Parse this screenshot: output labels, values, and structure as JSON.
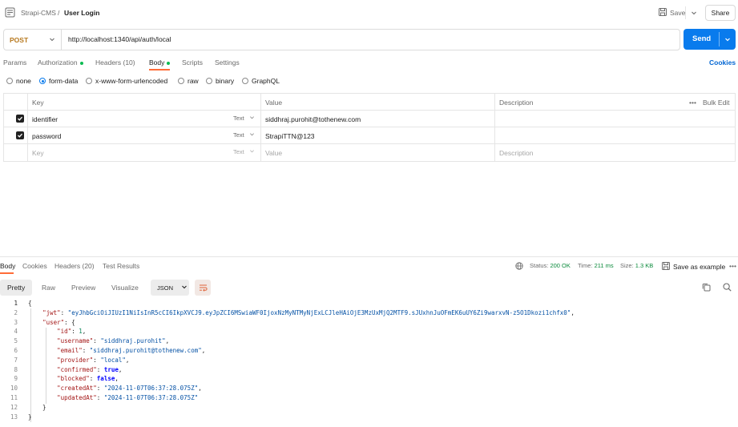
{
  "header": {
    "collection": "Strapi-CMS",
    "separator": "/",
    "request_name": "User Login",
    "save_label": "Save",
    "share_label": "Share"
  },
  "request": {
    "method": "POST",
    "url": "http://localhost:1340/api/auth/local",
    "send_label": "Send",
    "tabs": [
      "Params",
      "Authorization",
      "Headers (10)",
      "Body",
      "Scripts",
      "Settings"
    ],
    "active_tab": "Body",
    "cookies_label": "Cookies",
    "body_types": [
      "none",
      "form-data",
      "x-www-form-urlencoded",
      "raw",
      "binary",
      "GraphQL"
    ],
    "selected_body_type": "form-data"
  },
  "form_table": {
    "headers": {
      "key": "Key",
      "value": "Value",
      "description": "Description",
      "bulk_edit": "Bulk Edit"
    },
    "rows": [
      {
        "key": "identifier",
        "type": "Text",
        "value": "siddhraj.purohit@tothenew.com",
        "checked": true
      },
      {
        "key": "password",
        "type": "Text",
        "value": "StrapiTTN@123",
        "checked": true
      }
    ],
    "placeholder": {
      "key": "Key",
      "type": "Text",
      "value": "Value",
      "description": "Description"
    }
  },
  "response": {
    "tabs": [
      "Body",
      "Cookies",
      "Headers (20)",
      "Test Results"
    ],
    "active_tab": "Body",
    "status_label": "Status:",
    "status_value": "200 OK",
    "time_label": "Time:",
    "time_value": "211 ms",
    "size_label": "Size:",
    "size_value": "1.3 KB",
    "save_example_label": "Save as example",
    "view_modes": [
      "Pretty",
      "Raw",
      "Preview",
      "Visualize"
    ],
    "active_view": "Pretty",
    "format": "JSON",
    "json": {
      "jwt": "eyJhbGciOiJIUzI1NiIsInR5cCI6IkpXVCJ9.eyJpZCI6MSwiaWF0IjoxNzMyNTMyNjExLCJleHAiOjE3MzUxMjQ2MTF9.sJUxhnJuOFmEK6uUY6Zi9warxvN-z5O1Dkozi1chfx0",
      "id": "1",
      "username": "siddhraj.purohit",
      "email": "siddhraj.purohit@tothenew.com",
      "provider": "local",
      "confirmed": "true",
      "blocked": "false",
      "createdAt": "2024-11-07T06:37:28.075Z",
      "updatedAt": "2024-11-07T06:37:28.075Z"
    }
  }
}
